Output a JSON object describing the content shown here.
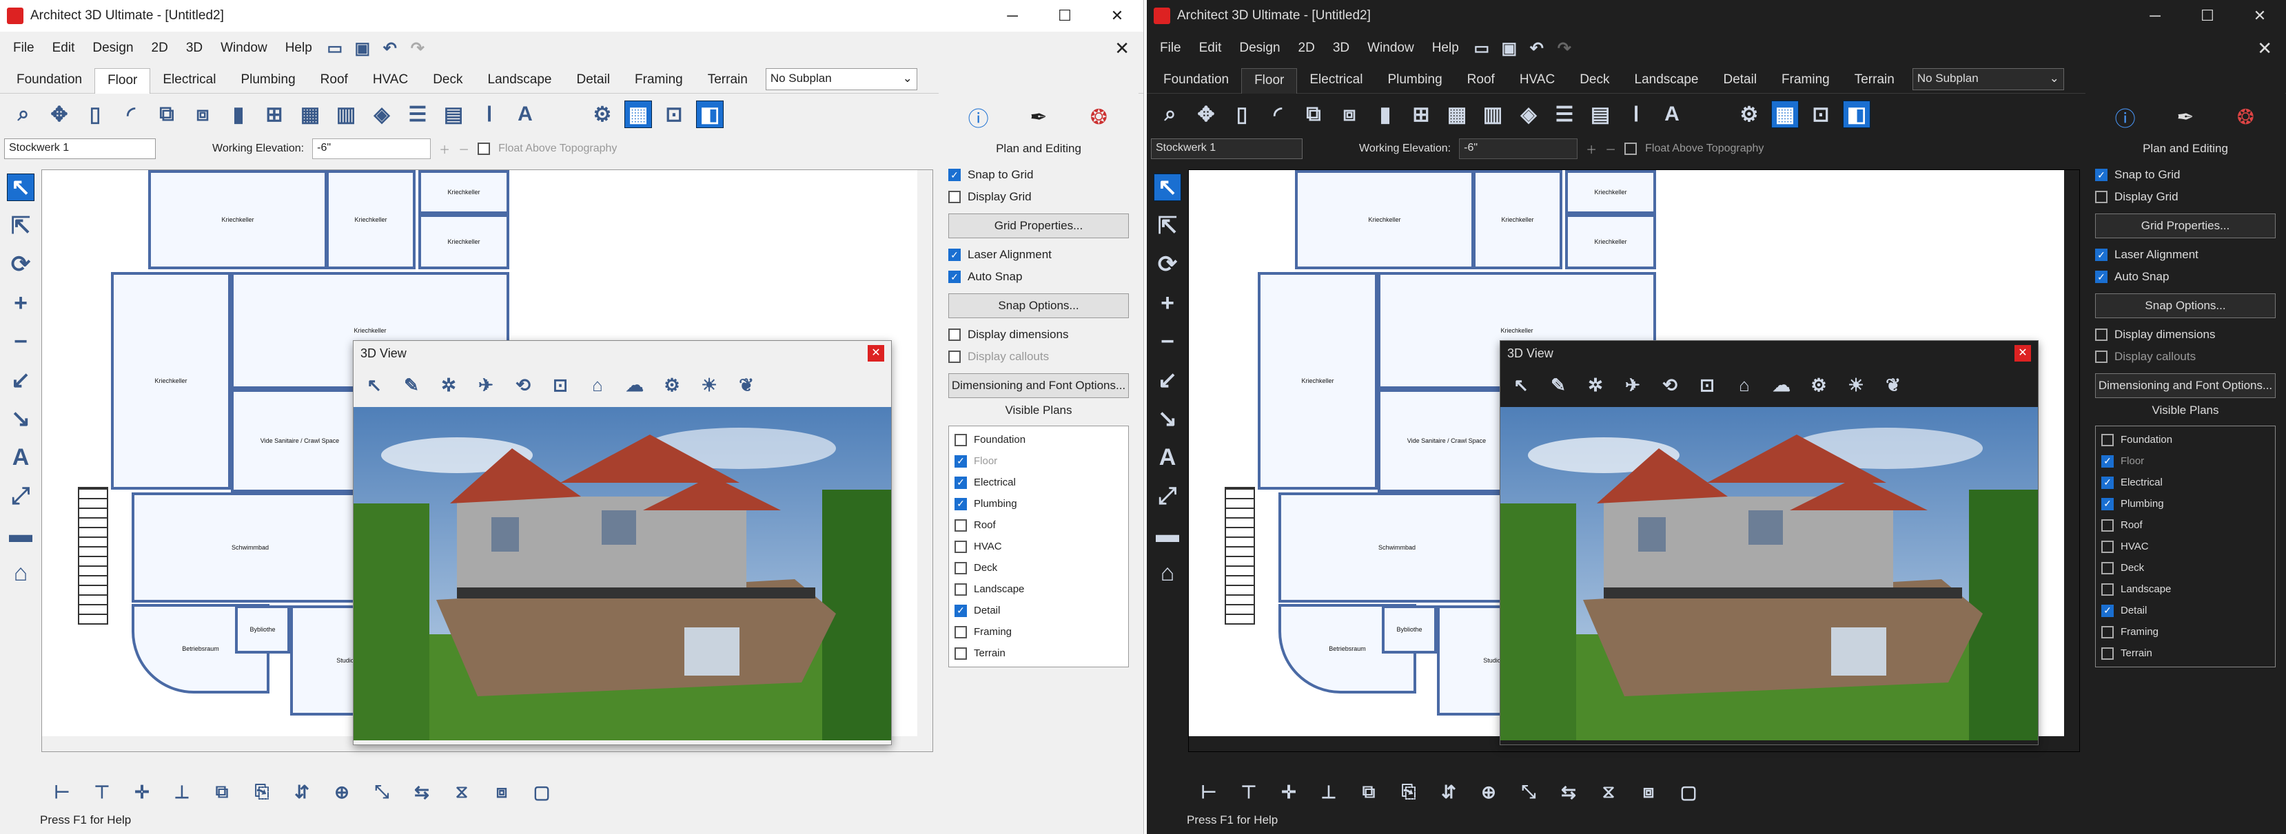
{
  "app_title": "Architect 3D Ultimate - [Untitled2]",
  "menu": [
    "File",
    "Edit",
    "Design",
    "2D",
    "3D",
    "Window",
    "Help"
  ],
  "tabs": [
    "Foundation",
    "Floor",
    "Electrical",
    "Plumbing",
    "Roof",
    "HVAC",
    "Deck",
    "Landscape",
    "Detail",
    "Framing",
    "Terrain"
  ],
  "active_tab": "Floor",
  "subplan": "No Subplan",
  "story_select": "Stockwerk 1",
  "working_elevation_label": "Working Elevation:",
  "working_elevation_value": "-6\"",
  "float_label": "Float Above Topography",
  "panel": {
    "title": "Plan and Editing",
    "snap_to_grid": "Snap to Grid",
    "display_grid": "Display Grid",
    "grid_props": "Grid Properties...",
    "laser_alignment": "Laser Alignment",
    "auto_snap": "Auto Snap",
    "snap_options": "Snap Options...",
    "display_dimensions": "Display dimensions",
    "display_callouts": "Display callouts",
    "dim_font_options": "Dimensioning and Font Options...",
    "visible_plans_title": "Visible Plans",
    "visible_plans": [
      {
        "label": "Foundation",
        "checked": false,
        "disabled": false
      },
      {
        "label": "Floor",
        "checked": true,
        "disabled": true
      },
      {
        "label": "Electrical",
        "checked": true,
        "disabled": false
      },
      {
        "label": "Plumbing",
        "checked": true,
        "disabled": false
      },
      {
        "label": "Roof",
        "checked": false,
        "disabled": false
      },
      {
        "label": "HVAC",
        "checked": false,
        "disabled": false
      },
      {
        "label": "Deck",
        "checked": false,
        "disabled": false
      },
      {
        "label": "Landscape",
        "checked": false,
        "disabled": false
      },
      {
        "label": "Detail",
        "checked": true,
        "disabled": false
      },
      {
        "label": "Framing",
        "checked": false,
        "disabled": false
      },
      {
        "label": "Terrain",
        "checked": false,
        "disabled": false
      }
    ]
  },
  "rooms": [
    "Kriechkeller",
    "Kriechkeller",
    "Kriechkeller",
    "Kriechkeller",
    "Kriechkeller",
    "Kriechkeller",
    "Vide Sanitaire / Crawl Space",
    "Schwimmbad",
    "Betriebsraum",
    "Bybliothe",
    "Studio"
  ],
  "view3d_title": "3D View",
  "status_text": "Press F1 for Help",
  "colors": {
    "accent": "#1a6fd1",
    "wall": "#4a6aa5",
    "close_red": "#d22"
  }
}
